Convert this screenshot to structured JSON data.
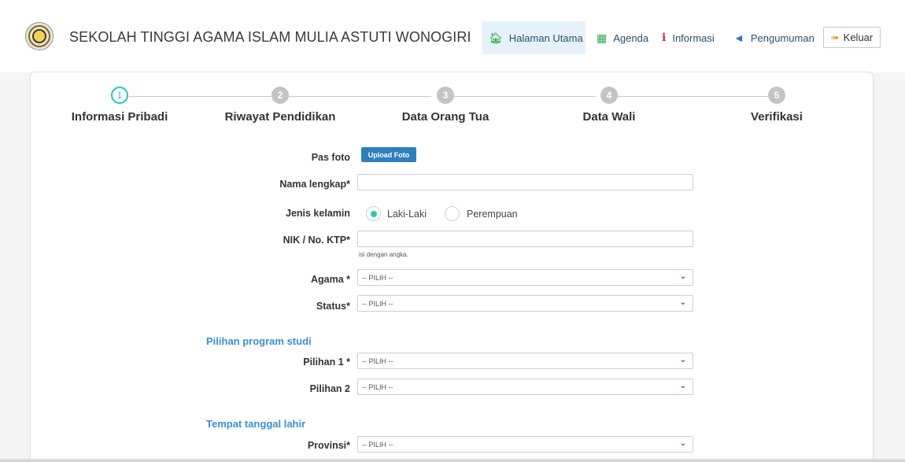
{
  "header": {
    "brand": "SEKOLAH TINGGI AGAMA ISLAM MULIA ASTUTI WONOGIRI",
    "logo_icon": "institution-seal-icon",
    "nav": [
      {
        "label": "Halaman Utama",
        "icon": "home-icon",
        "active": true
      },
      {
        "label": "Agenda",
        "icon": "calendar-icon"
      },
      {
        "label": "Informasi",
        "icon": "info-icon"
      },
      {
        "label": "Pengumuman",
        "icon": "megaphone-icon"
      }
    ],
    "logout_label": "Keluar",
    "logout_icon": "sign-out-icon"
  },
  "wizard": {
    "steps": [
      {
        "number": "1",
        "label": "Informasi Pribadi",
        "active": true
      },
      {
        "number": "2",
        "label": "Riwayat Pendidikan"
      },
      {
        "number": "3",
        "label": "Data Orang Tua"
      },
      {
        "number": "4",
        "label": "Data Wali"
      },
      {
        "number": "5",
        "label": "Verifikasi"
      }
    ],
    "accent_color": "#29c8b0"
  },
  "form": {
    "photo_label": "Pas foto",
    "upload_button": "Upload Foto",
    "name_label": "Nama lengkap*",
    "name_value": "",
    "gender_label": "Jenis kelamin",
    "gender_options": [
      "Laki-Laki",
      "Perempuan"
    ],
    "gender_selected": "Laki-Laki",
    "nik_label": "NIK / No. KTP*",
    "nik_value": "",
    "nik_help": "isi dengan angka.",
    "religion_label": "Agama *",
    "religion_value": "-- PILIH --",
    "status_label": "Status*",
    "status_value": "-- PILIH --",
    "program_section": "Pilihan program studi",
    "choice1_label": "Pilihan 1 *",
    "choice1_value": "-- PILIH --",
    "choice2_label": "Pilihan 2",
    "choice2_value": "-- PILIH --",
    "birth_section": "Tempat tanggal lahir",
    "province_label": "Provinsi*",
    "province_value": "-- PILIH --"
  }
}
